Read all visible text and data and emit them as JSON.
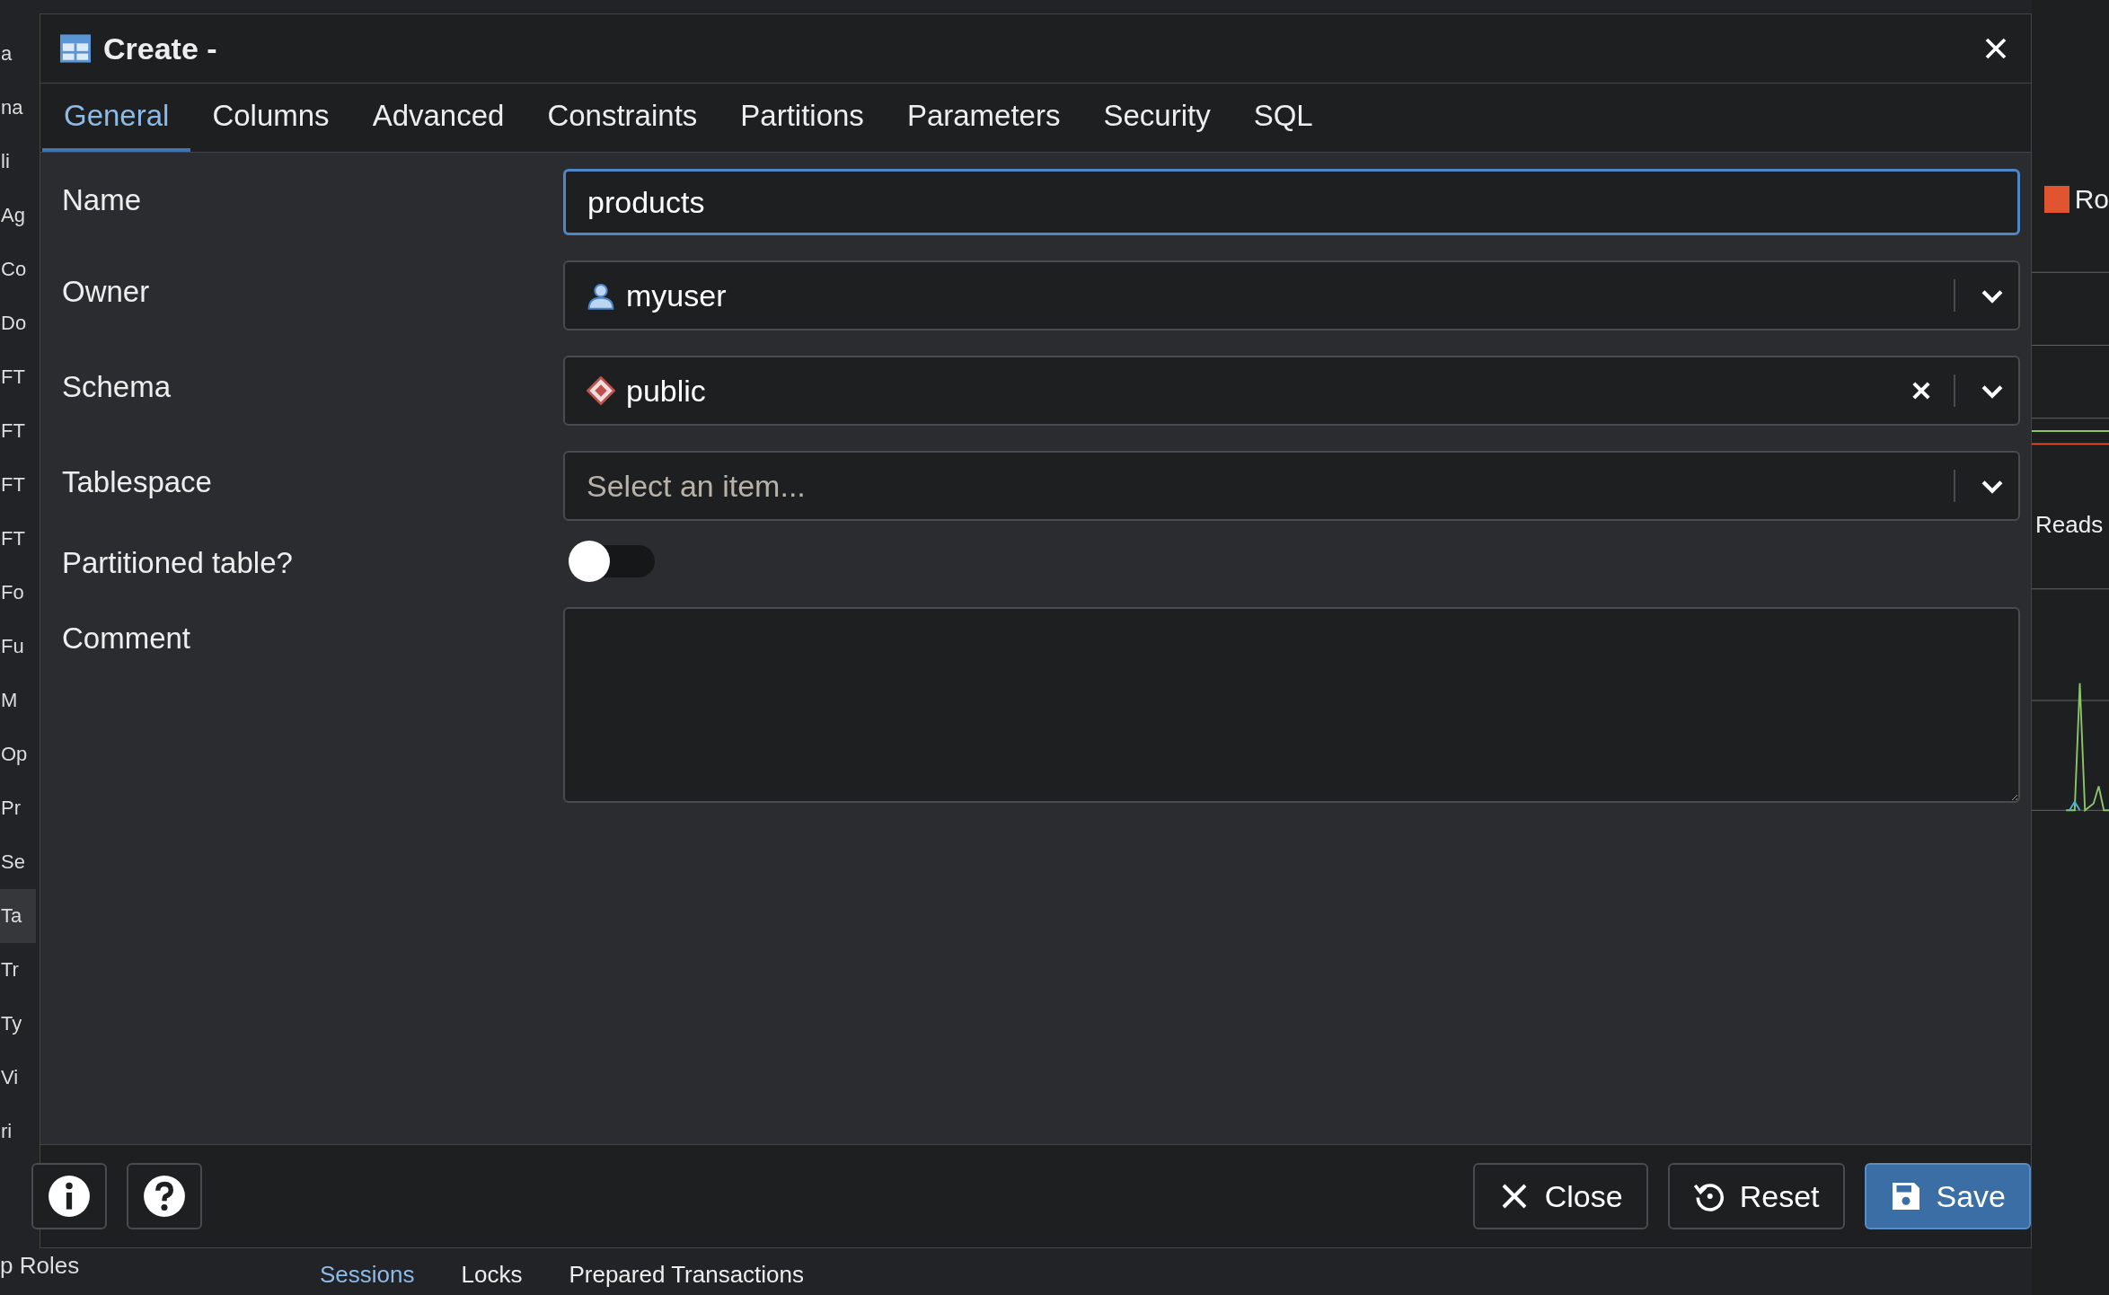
{
  "background": {
    "sidebar_fragments": [
      {
        "text": "a",
        "selected": false
      },
      {
        "text": "na",
        "selected": false
      },
      {
        "text": "li",
        "selected": false
      },
      {
        "text": "Ag",
        "selected": false
      },
      {
        "text": "Co",
        "selected": false
      },
      {
        "text": "Do",
        "selected": false
      },
      {
        "text": "FT",
        "selected": false
      },
      {
        "text": "FT",
        "selected": false
      },
      {
        "text": "FT",
        "selected": false
      },
      {
        "text": "FT",
        "selected": false
      },
      {
        "text": "Fo",
        "selected": false
      },
      {
        "text": "Fu",
        "selected": false
      },
      {
        "text": "M",
        "selected": false
      },
      {
        "text": "Op",
        "selected": false
      },
      {
        "text": "Pr",
        "selected": false
      },
      {
        "text": "Se",
        "selected": false
      },
      {
        "text": "Ta",
        "selected": true
      },
      {
        "text": "Tr",
        "selected": false
      },
      {
        "text": "Ty",
        "selected": false
      },
      {
        "text": "Vi",
        "selected": false
      },
      {
        "text": "ri",
        "selected": false
      }
    ],
    "tree_fragment": "p Roles",
    "legend": {
      "label": "Ro",
      "color": "#e0552f"
    },
    "chart_title": "Reads",
    "bottom_tabs": [
      {
        "label": "Sessions",
        "selected": true
      },
      {
        "label": "Locks",
        "selected": false
      },
      {
        "label": "Prepared Transactions",
        "selected": false
      }
    ]
  },
  "dialog": {
    "title": "Create -",
    "tabs": [
      {
        "label": "General",
        "selected": true
      },
      {
        "label": "Columns",
        "selected": false
      },
      {
        "label": "Advanced",
        "selected": false
      },
      {
        "label": "Constraints",
        "selected": false
      },
      {
        "label": "Partitions",
        "selected": false
      },
      {
        "label": "Parameters",
        "selected": false
      },
      {
        "label": "Security",
        "selected": false
      },
      {
        "label": "SQL",
        "selected": false
      }
    ],
    "fields": [
      {
        "kind": "text",
        "label": "Name",
        "value": "products",
        "focused": true
      },
      {
        "kind": "select",
        "label": "Owner",
        "value": "myuser",
        "clearable": false
      },
      {
        "kind": "select",
        "label": "Schema",
        "value": "public",
        "clearable": true
      },
      {
        "kind": "select",
        "label": "Tablespace",
        "placeholder": "Select an item...",
        "clearable": false
      },
      {
        "kind": "toggle",
        "label": "Partitioned table?",
        "on": false
      },
      {
        "kind": "textarea",
        "label": "Comment"
      }
    ],
    "buttons": [
      {
        "label": "Close",
        "kind": "close"
      },
      {
        "label": "Reset",
        "kind": "reset"
      },
      {
        "label": "Save",
        "kind": "save"
      }
    ]
  }
}
